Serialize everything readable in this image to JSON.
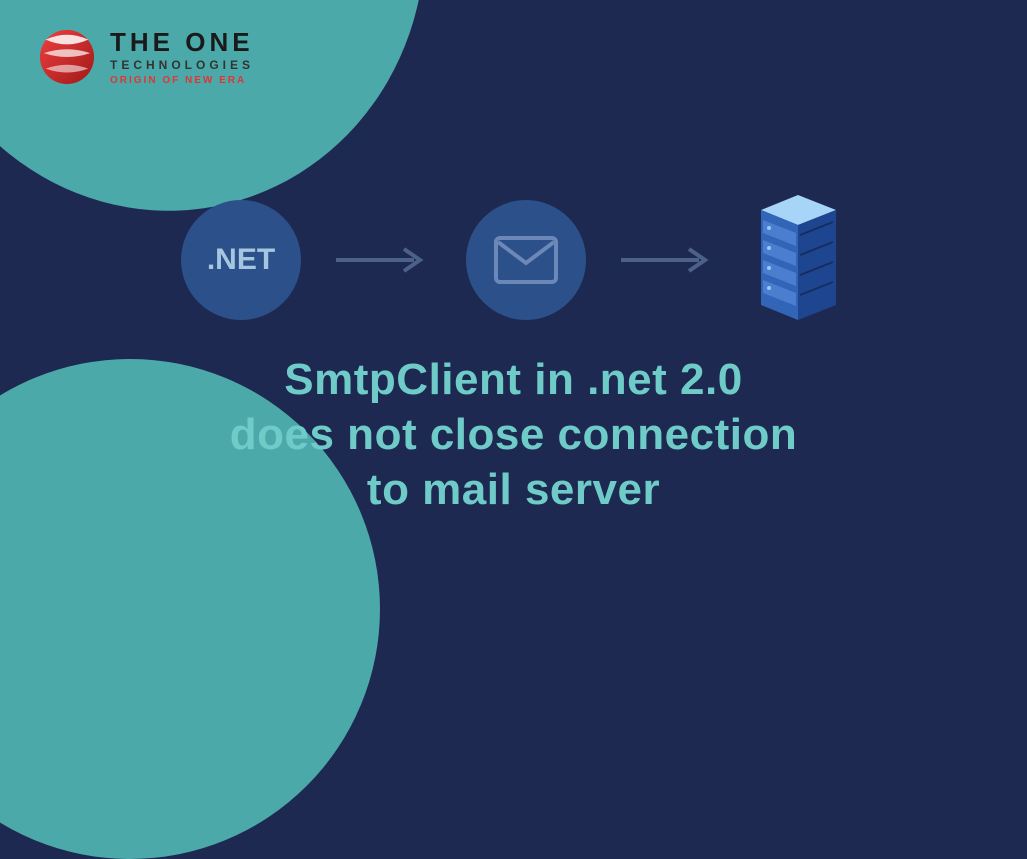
{
  "logo": {
    "title": "THE ONE",
    "subtitle": "TECHNOLOGIES",
    "tagline": "ORIGIN OF NEW ERA"
  },
  "diagram": {
    "net_label": ".NET"
  },
  "heading": {
    "line1": "SmtpClient in .net 2.0",
    "line2": "does not close connection",
    "line3": "to mail server"
  }
}
